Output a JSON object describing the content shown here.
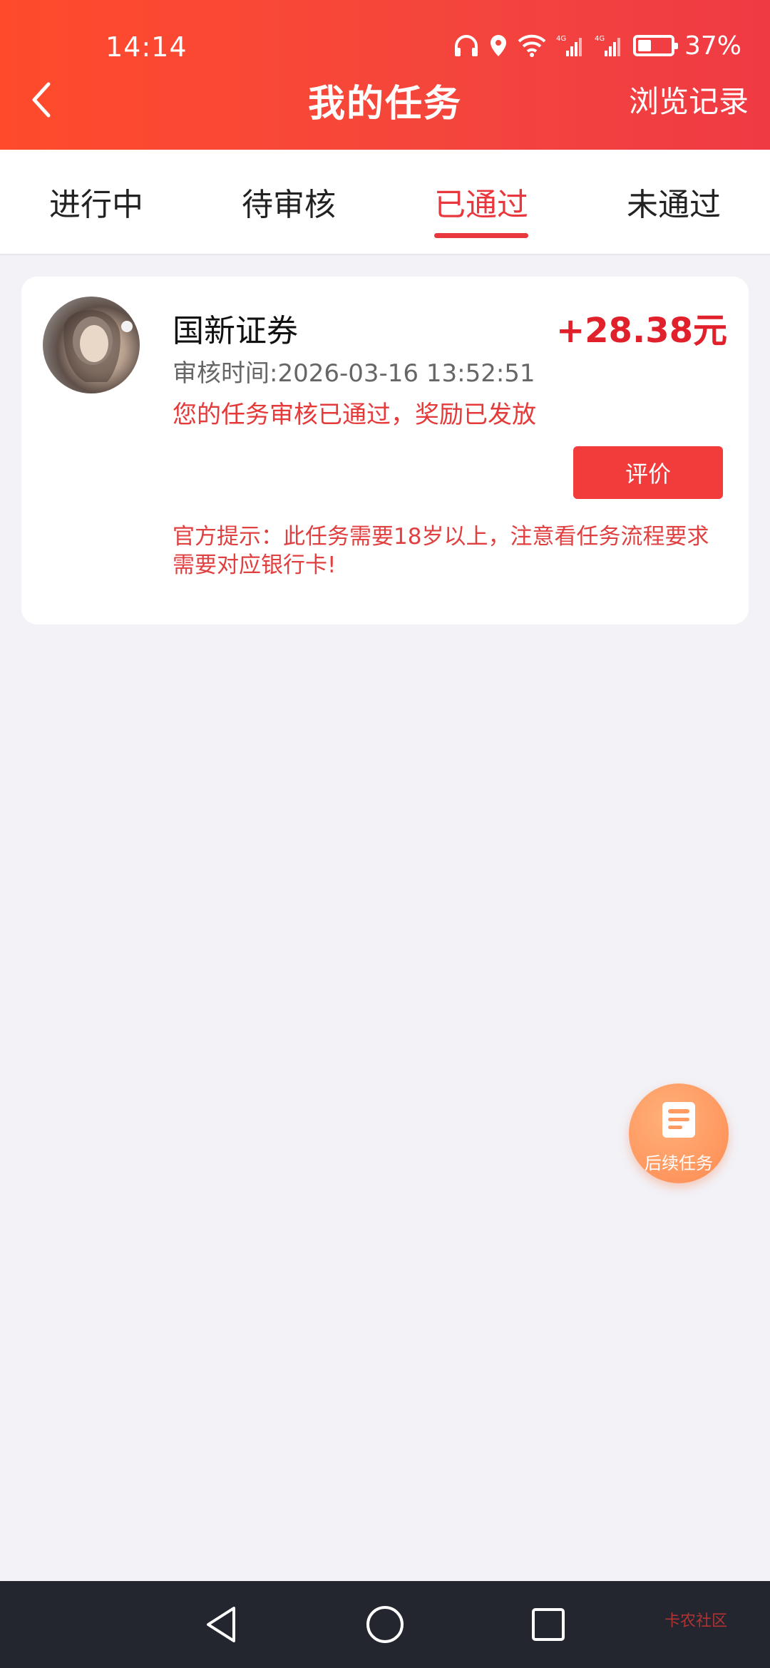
{
  "status_bar": {
    "time": "14:14",
    "battery_percent": "37%",
    "network_1": "4G",
    "network_2": "4G"
  },
  "header": {
    "title": "我的任务",
    "history_link": "浏览记录"
  },
  "tabs": [
    {
      "label": "进行中",
      "active": false
    },
    {
      "label": "待审核",
      "active": false
    },
    {
      "label": "已通过",
      "active": true
    },
    {
      "label": "未通过",
      "active": false
    }
  ],
  "task_card": {
    "title": "国新证券",
    "reward": "+28.38元",
    "review_time": "审核时间:2026-03-16 13:52:51",
    "status_message": "您的任务审核已通过，奖励已发放",
    "evaluate_button": "评价",
    "tip": "官方提示：此任务需要18岁以上，注意看任务流程要求需要对应银行卡!"
  },
  "fab": {
    "label": "后续任务"
  },
  "watermark": {
    "text": "卡农社区"
  },
  "colors": {
    "header_start": "#ff4a2b",
    "header_end": "#ef3a44",
    "accent_red": "#e8383d",
    "reward_red": "#e0202a",
    "fab_orange": "#ff9a62",
    "background": "#f2f2f7"
  }
}
